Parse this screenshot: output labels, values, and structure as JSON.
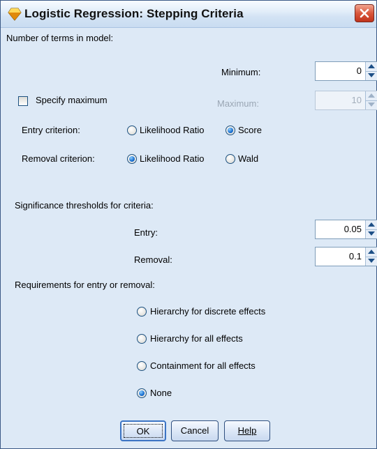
{
  "window": {
    "title": "Logistic Regression: Stepping Criteria"
  },
  "terms": {
    "heading": "Number of terms in model:",
    "minimum_label": "Minimum:",
    "minimum_value": "0",
    "specify_maximum_label": "Specify maximum",
    "specify_maximum_checked": false,
    "maximum_label": "Maximum:",
    "maximum_value": "10"
  },
  "entry_criterion": {
    "label": "Entry criterion:",
    "options": [
      "Likelihood Ratio",
      "Score"
    ],
    "selected": "Score"
  },
  "removal_criterion": {
    "label": "Removal criterion:",
    "options": [
      "Likelihood Ratio",
      "Wald"
    ],
    "selected": "Likelihood Ratio"
  },
  "significance": {
    "heading": "Significance thresholds for criteria:",
    "entry_label": "Entry:",
    "entry_value": "0.05",
    "removal_label": "Removal:",
    "removal_value": "0.1"
  },
  "requirements": {
    "heading": "Requirements for entry or removal:",
    "options": [
      "Hierarchy for discrete effects",
      "Hierarchy for all effects",
      "Containment for all effects",
      "None"
    ],
    "selected": "None"
  },
  "buttons": {
    "ok": "OK",
    "cancel": "Cancel",
    "help": "Help"
  }
}
